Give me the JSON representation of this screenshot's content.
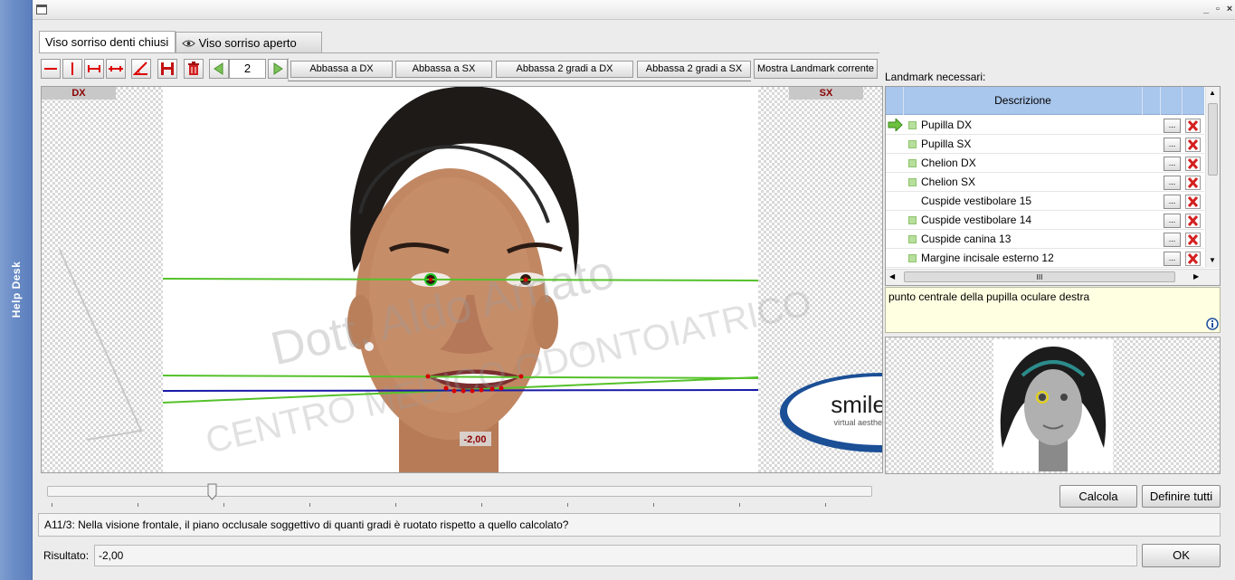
{
  "sidebar": {
    "label": "Help Desk"
  },
  "tabs": [
    {
      "label": "Viso sorriso denti chiusi",
      "active": true
    },
    {
      "label": "Viso sorriso aperto",
      "icon": "eye-icon",
      "active": false
    }
  ],
  "toolbar": {
    "page_number": "2",
    "buttons": {
      "abbassa_dx": "Abbassa a DX",
      "abbassa_sx": "Abbassa a SX",
      "abbassa2_dx": "Abbassa 2 gradi a DX",
      "abbassa2_sx": "Abbassa 2 gradi a SX",
      "mostra": "Mostra Landmark corrente"
    }
  },
  "image": {
    "left_label": "DX",
    "right_label": "SX",
    "watermark1": "Dott. Aldo Amato",
    "watermark2": "CENTRO MEDICO ODONTOIATRICO",
    "angle_value": "-2,00",
    "logo_text": "smiletron",
    "logo_tagline": "virtual aesthetic dentistry"
  },
  "landmarks": {
    "title": "Landmark necessari:",
    "column_header": "Descrizione",
    "scroll_mid": "III",
    "rows": [
      {
        "label": "Pupilla DX",
        "current": true,
        "marked": true
      },
      {
        "label": "Pupilla SX",
        "current": false,
        "marked": true
      },
      {
        "label": "Chelion DX",
        "current": false,
        "marked": true
      },
      {
        "label": "Chelion SX",
        "current": false,
        "marked": true
      },
      {
        "label": "Cuspide vestibolare 15",
        "current": false,
        "marked": false
      },
      {
        "label": "Cuspide vestibolare 14",
        "current": false,
        "marked": true
      },
      {
        "label": "Cuspide canina 13",
        "current": false,
        "marked": true
      },
      {
        "label": "Margine incisale esterno 12",
        "current": false,
        "marked": true
      }
    ],
    "row_button": "...",
    "description": "punto centrale della pupilla oculare destra"
  },
  "actions": {
    "calcola": "Calcola",
    "definire": "Definire tutti",
    "ok": "OK"
  },
  "question": "A11/3: Nella visione frontale, il piano occlusale soggettivo di quanti gradi è ruotato rispetto a quello calcolato?",
  "result": {
    "label": "Risultato:",
    "value": "-2,00"
  },
  "slider": {
    "value_fraction": 0.2
  },
  "colors": {
    "accent": "#a9c6ec",
    "line_green": "#55c12a",
    "line_blue": "#1a1aa8",
    "delete_red": "#d42020"
  }
}
